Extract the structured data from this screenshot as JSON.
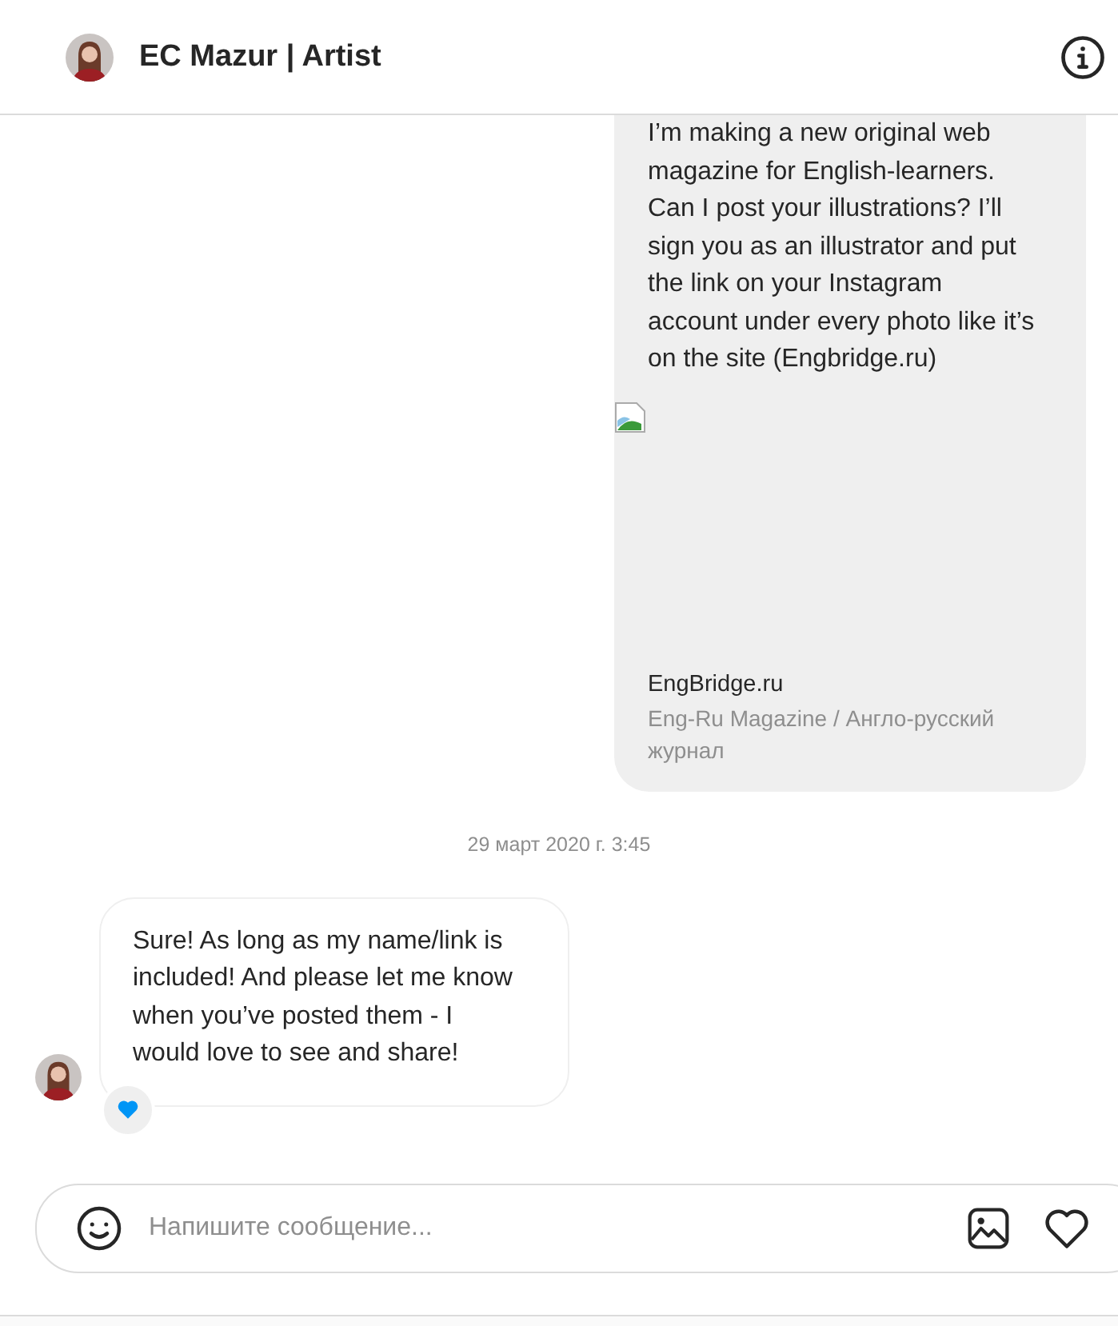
{
  "header": {
    "title": "EC Mazur | Artist"
  },
  "messages": [
    {
      "kind": "outgoing",
      "text": "I’m making a new original web magazine for English-learners. Can I post your illustrations? I’ll sign you as an illustrator and put the link on your Instagram account under every photo like it’s on the site (Engbridge.ru)",
      "link_preview": {
        "title": "EngBridge.ru",
        "description": "Eng-Ru Magazine / Англо-русский журнал"
      }
    },
    {
      "kind": "timestamp",
      "text": "29 март 2020 г. 3:45"
    },
    {
      "kind": "incoming",
      "text": "Sure! As long as my name/link is included! And please let me know when you’ve posted them - I would love to see and share!",
      "liked": true
    }
  ],
  "composer": {
    "placeholder": "Напишите сообщение..."
  }
}
